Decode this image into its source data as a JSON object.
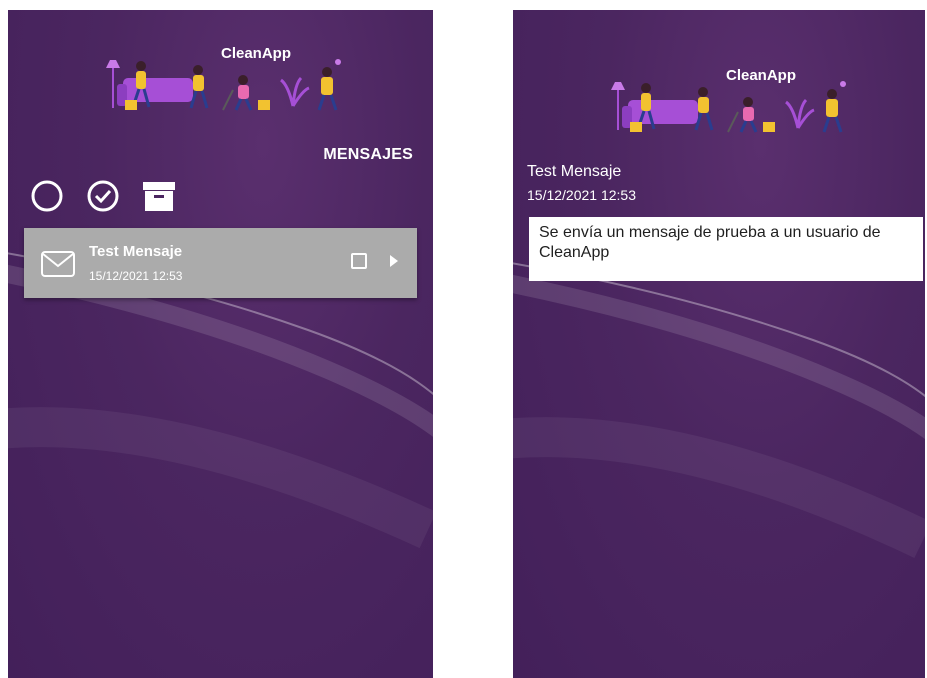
{
  "app": {
    "brand_name": "CleanApp"
  },
  "list_screen": {
    "title": "MENSAJES",
    "toolbar": [
      {
        "icon": "circle-outline-icon"
      },
      {
        "icon": "check-circle-icon"
      },
      {
        "icon": "archive-box-icon"
      }
    ],
    "messages": [
      {
        "title": "Test Mensaje",
        "date": "15/12/2021 12:53"
      }
    ]
  },
  "detail_screen": {
    "title": "Test Mensaje",
    "date": "15/12/2021 12:53",
    "body": "Se envía un mensaje de prueba a un usuario de CleanApp"
  },
  "colors": {
    "background": "#4b2660",
    "row_background": "#ababab",
    "text": "#ffffff",
    "accent_purple": "#a64fd6",
    "accent_yellow": "#f2c230"
  }
}
